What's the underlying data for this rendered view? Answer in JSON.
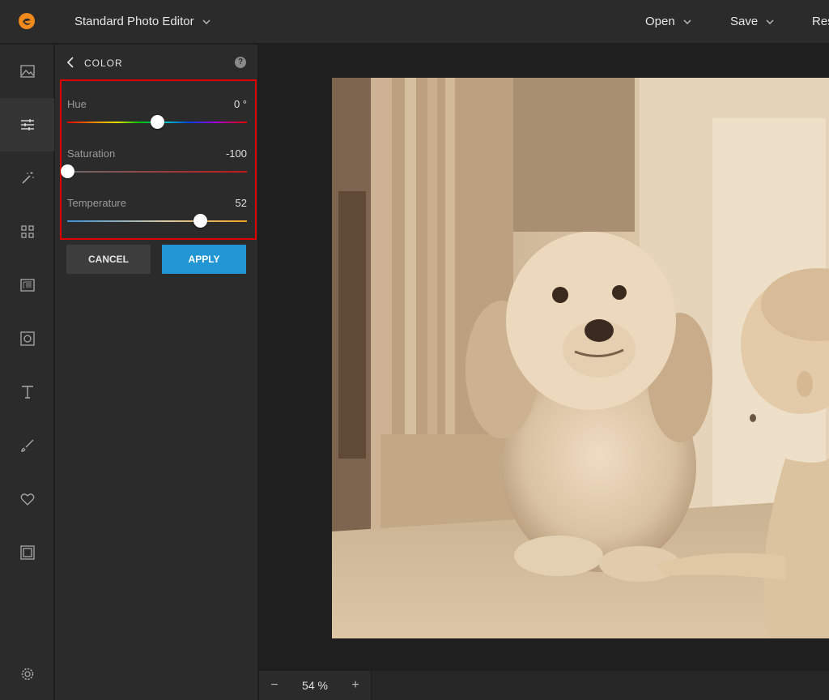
{
  "app": {
    "title": "Standard Photo Editor",
    "menu": [
      {
        "label": "Open"
      },
      {
        "label": "Save"
      },
      {
        "label": "Res"
      }
    ]
  },
  "rail": {
    "items": [
      {
        "name": "image",
        "icon": "image-icon"
      },
      {
        "name": "adjust",
        "icon": "sliders-icon",
        "active": true
      },
      {
        "name": "effects",
        "icon": "magic-wand-icon"
      },
      {
        "name": "layouts",
        "icon": "grid-icon"
      },
      {
        "name": "texture",
        "icon": "texture-icon"
      },
      {
        "name": "frames",
        "icon": "frame-circle-icon"
      },
      {
        "name": "text",
        "icon": "text-icon"
      },
      {
        "name": "draw",
        "icon": "brush-icon"
      },
      {
        "name": "stickers",
        "icon": "heart-icon"
      },
      {
        "name": "border",
        "icon": "border-icon"
      },
      {
        "name": "settings",
        "icon": "gear-icon"
      }
    ]
  },
  "panel": {
    "title": "COLOR",
    "help": "?",
    "sliders": [
      {
        "label": "Hue",
        "value_text": "0 °",
        "position": 0.5
      },
      {
        "label": "Saturation",
        "value_text": "-100",
        "position": 0.0
      },
      {
        "label": "Temperature",
        "value_text": "52",
        "position": 0.74
      }
    ],
    "cancel_label": "CANCEL",
    "apply_label": "APPLY"
  },
  "zoom": {
    "minus": "−",
    "value": "54 %",
    "plus": "+"
  },
  "colors": {
    "accent": "#2296d4",
    "highlight": "#e00000",
    "logo": "#f08a1c"
  }
}
